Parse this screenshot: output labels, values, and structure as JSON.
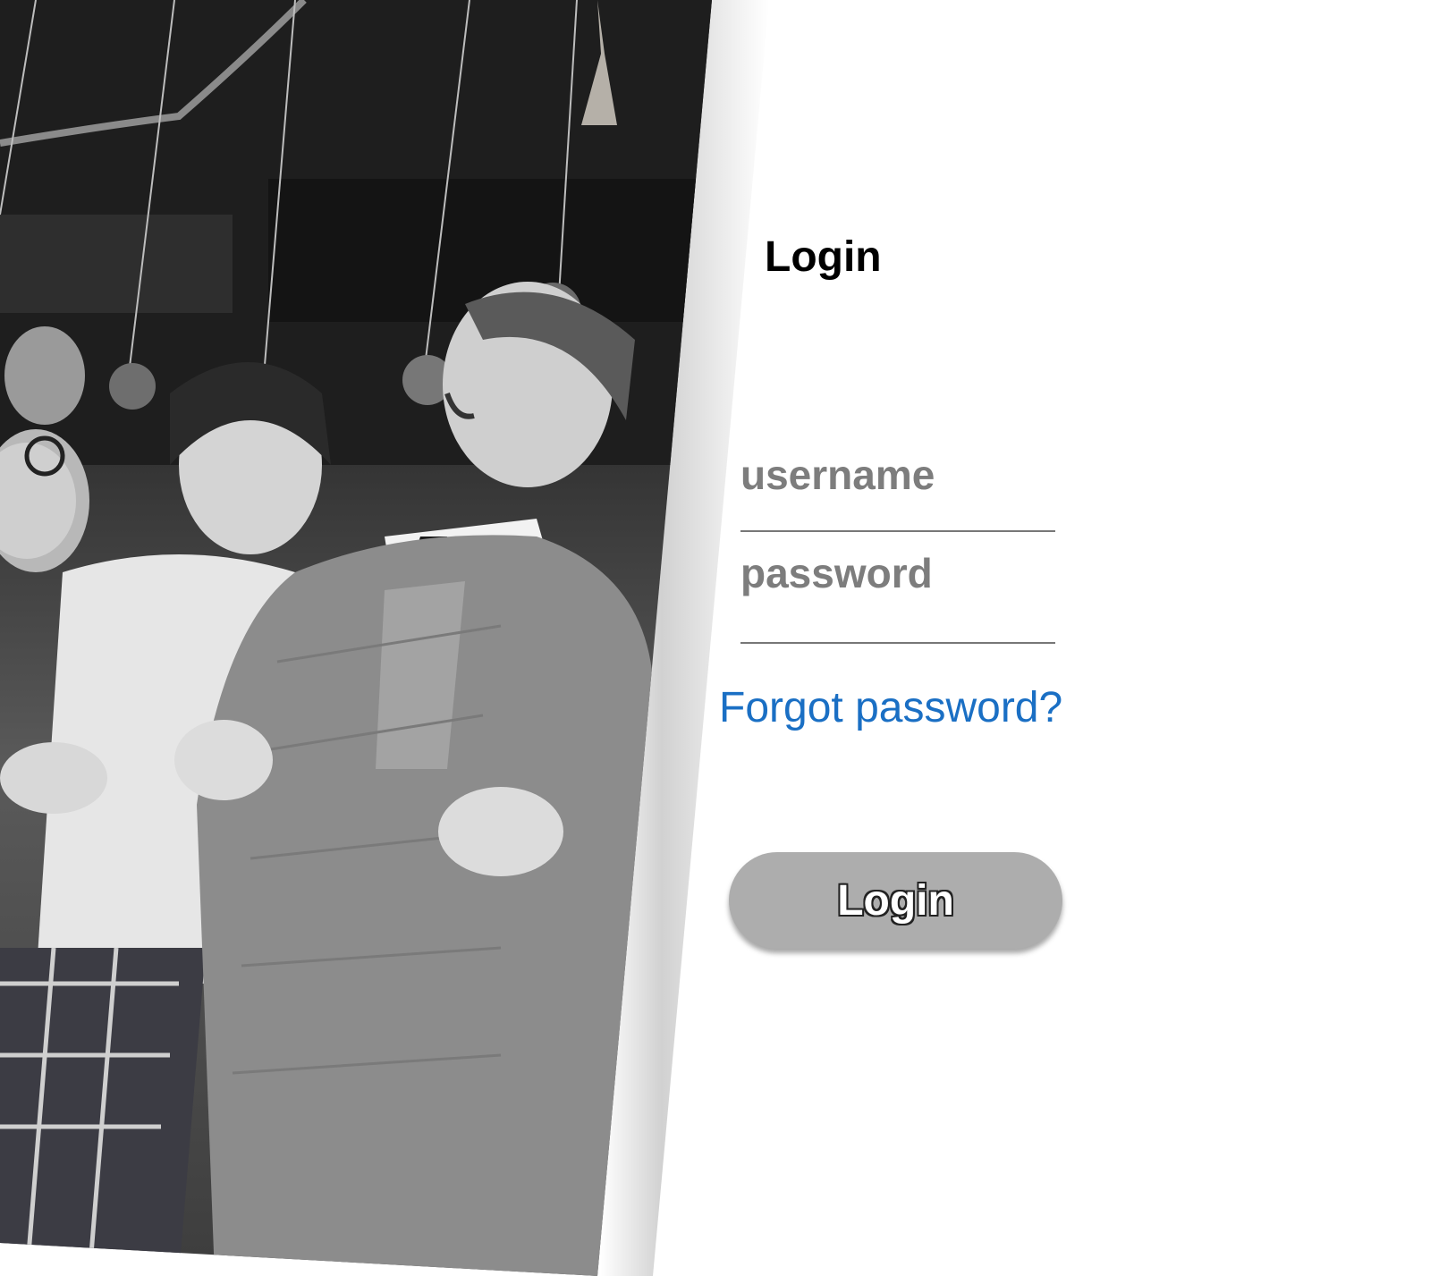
{
  "photo": {
    "alt": "Black and white photo of teenagers bobbing for apples hanging on strings"
  },
  "login_form": {
    "title": "Login",
    "username_placeholder": "username",
    "password_placeholder": "password",
    "forgot_password_link": "Forgot password?",
    "login_button_label": "Login"
  },
  "colors": {
    "link": "#1a6fc4",
    "button_bg": "#adadad",
    "input_underline": "#777777",
    "placeholder": "#7d7d7d"
  }
}
